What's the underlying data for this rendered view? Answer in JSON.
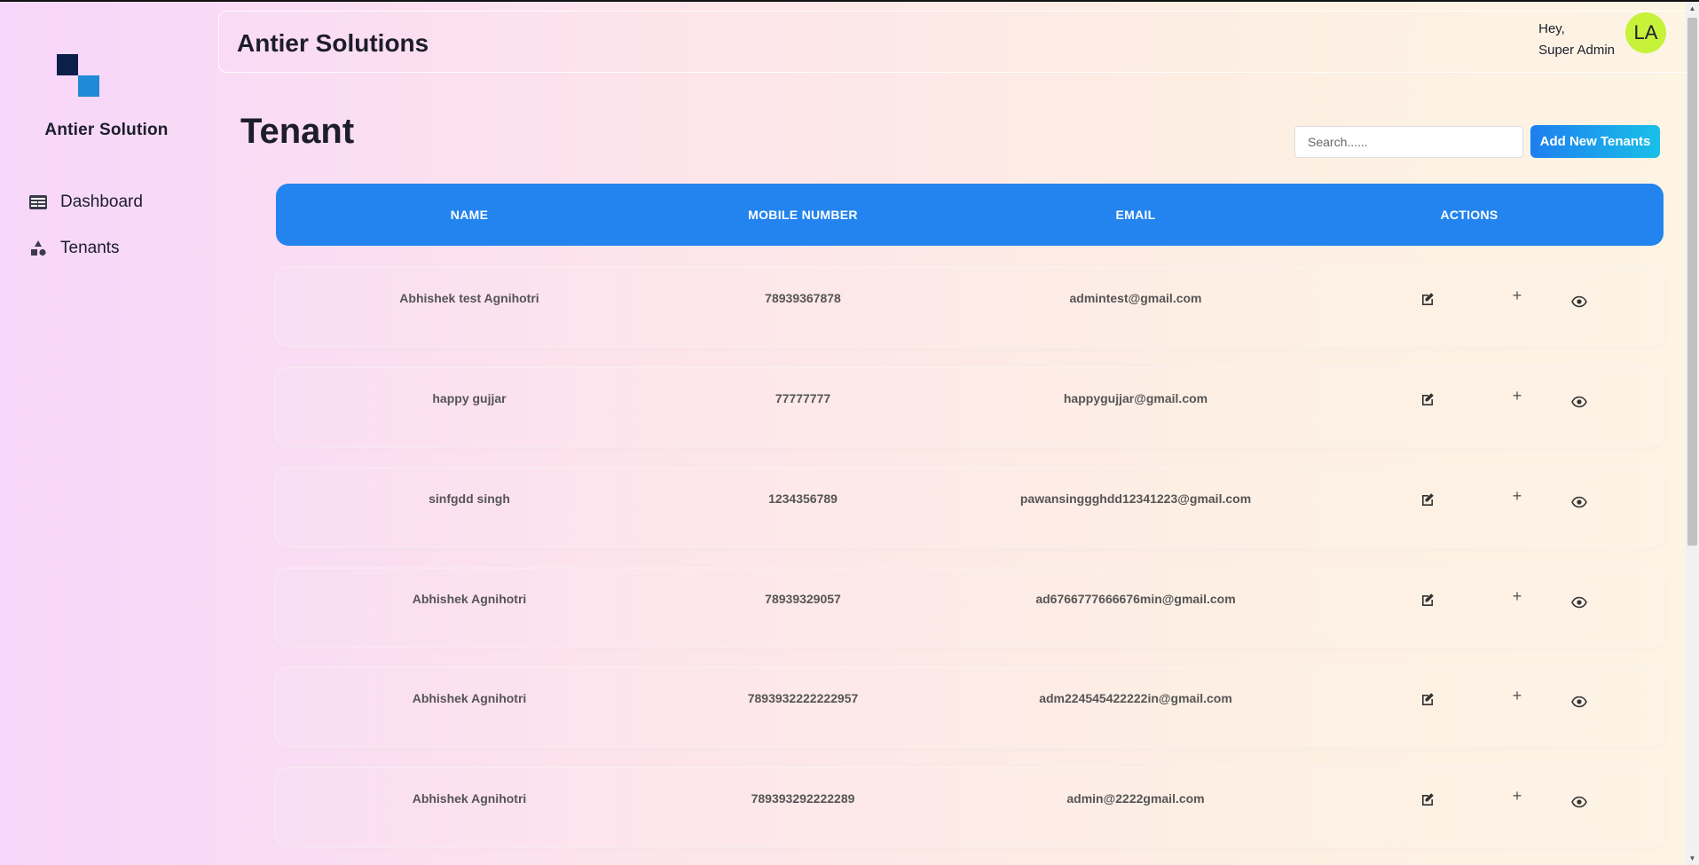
{
  "sidebar": {
    "brand": "Antier Solution",
    "items": [
      {
        "label": "Dashboard",
        "icon": "dashboard-icon"
      },
      {
        "label": "Tenants",
        "icon": "shapes-icon"
      }
    ]
  },
  "header": {
    "title": "Antier Solutions",
    "greeting": "Hey,",
    "user_role": "Super Admin",
    "avatar_initials": "LA",
    "avatar_color": "#c6f23a"
  },
  "page": {
    "title": "Tenant",
    "search_placeholder": "Search......",
    "add_button_label": "Add New Tenants"
  },
  "table": {
    "header_color": "#2384ef",
    "columns": [
      "NAME",
      "MOBILE NUMBER",
      "EMAIL",
      "ACTIONS"
    ],
    "rows": [
      {
        "name": "Abhishek test Agnihotri",
        "mobile": "78939367878",
        "email": "admintest@gmail.com"
      },
      {
        "name": "happy gujjar",
        "mobile": "77777777",
        "email": "happygujjar@gmail.com"
      },
      {
        "name": "sinfgdd singh",
        "mobile": "1234356789",
        "email": "pawansinggghdd12341223@gmail.com"
      },
      {
        "name": "Abhishek Agnihotri",
        "mobile": "78939329057",
        "email": "ad6766777666676min@gmail.com"
      },
      {
        "name": "Abhishek Agnihotri",
        "mobile": "7893932222222957",
        "email": "adm224545422222in@gmail.com"
      },
      {
        "name": "Abhishek Agnihotri",
        "mobile": "789393292222289",
        "email": "admin@2222gmail.com"
      }
    ],
    "actions": [
      "edit-icon",
      "plus-icon",
      "eye-icon"
    ]
  }
}
